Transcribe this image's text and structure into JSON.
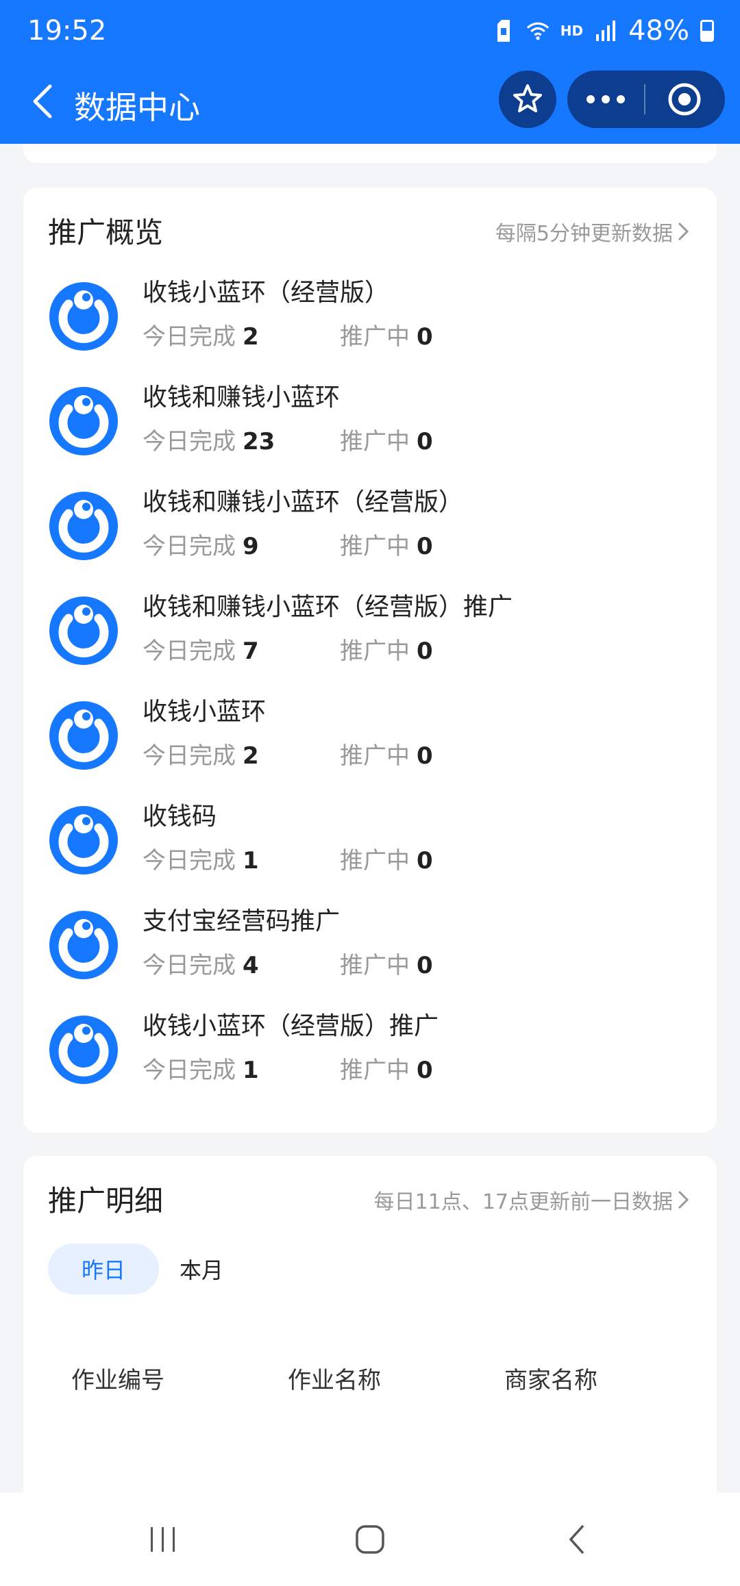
{
  "status_bar": {
    "time": "19:52",
    "network": "HD",
    "battery": "48%"
  },
  "header": {
    "title": "数据中心"
  },
  "overview": {
    "title": "推广概览",
    "hint": "每隔5分钟更新数据",
    "done_label": "今日完成",
    "promo_label": "推广中",
    "items": [
      {
        "name": "收钱小蓝环（经营版）",
        "done": "2",
        "promoting": "0"
      },
      {
        "name": "收钱和赚钱小蓝环",
        "done": "23",
        "promoting": "0"
      },
      {
        "name": "收钱和赚钱小蓝环（经营版）",
        "done": "9",
        "promoting": "0"
      },
      {
        "name": "收钱和赚钱小蓝环（经营版）推广",
        "done": "7",
        "promoting": "0"
      },
      {
        "name": "收钱小蓝环",
        "done": "2",
        "promoting": "0"
      },
      {
        "name": "收钱码",
        "done": "1",
        "promoting": "0"
      },
      {
        "name": "支付宝经营码推广",
        "done": "4",
        "promoting": "0"
      },
      {
        "name": "收钱小蓝环（经营版）推广",
        "done": "1",
        "promoting": "0"
      }
    ]
  },
  "detail": {
    "title": "推广明细",
    "hint": "每日11点、17点更新前一日数据",
    "tabs": [
      "昨日",
      "本月"
    ],
    "columns": [
      "作业编号",
      "作业名称",
      "商家名称"
    ]
  },
  "colors": {
    "brand": "#1677ff",
    "capsule": "#0d3d8f"
  }
}
